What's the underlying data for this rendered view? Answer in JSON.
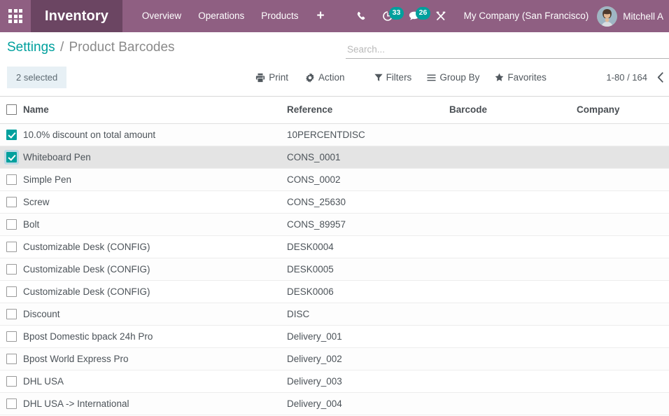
{
  "navbar": {
    "apps_icon": "apps-grid-icon",
    "brand": "Inventory",
    "menu_items": [
      {
        "label": "Overview"
      },
      {
        "label": "Operations"
      },
      {
        "label": "Products"
      }
    ],
    "plus_label": "+",
    "systray": [
      {
        "name": "phone-icon",
        "badge": null
      },
      {
        "name": "activity-clock-icon",
        "badge": "33"
      },
      {
        "name": "messages-chat-icon",
        "badge": "26"
      },
      {
        "name": "tools-wrench-icon",
        "badge": null
      }
    ],
    "company": "My Company (San Francisco)",
    "user_name": "Mitchell A",
    "avatar": "user-avatar",
    "colors": {
      "navbar": "#8f5f82",
      "brand": "#6b4562",
      "badge": "#00a09d"
    }
  },
  "control_panel": {
    "breadcrumb": {
      "root": "Settings",
      "separator": "/",
      "current": "Product Barcodes"
    },
    "search": {
      "value": "",
      "placeholder": "Search..."
    },
    "selection": {
      "label": "2 selected"
    },
    "actions": [
      {
        "label": "Print",
        "icon": "printer-icon"
      },
      {
        "label": "Action",
        "icon": "gear-icon"
      }
    ],
    "filters": [
      {
        "label": "Filters",
        "icon": "filter-funnel-icon"
      },
      {
        "label": "Group By",
        "icon": "group-by-lines-icon"
      },
      {
        "label": "Favorites",
        "icon": "star-icon"
      }
    ],
    "pager": {
      "range": "1-80 / 164",
      "prev_icon": "chevron-left-icon"
    }
  },
  "list": {
    "columns": [
      "Name",
      "Reference",
      "Barcode",
      "Company"
    ],
    "header_checkbox": false,
    "rows": [
      {
        "selected": true,
        "hover": false,
        "name": "10.0% discount on total amount",
        "reference": "10PERCENTDISC",
        "barcode": "",
        "company": ""
      },
      {
        "selected": true,
        "hover": true,
        "name": "Whiteboard Pen",
        "reference": "CONS_0001",
        "barcode": "",
        "company": ""
      },
      {
        "selected": false,
        "hover": false,
        "name": "Simple Pen",
        "reference": "CONS_0002",
        "barcode": "",
        "company": ""
      },
      {
        "selected": false,
        "hover": false,
        "name": "Screw",
        "reference": "CONS_25630",
        "barcode": "",
        "company": ""
      },
      {
        "selected": false,
        "hover": false,
        "name": "Bolt",
        "reference": "CONS_89957",
        "barcode": "",
        "company": ""
      },
      {
        "selected": false,
        "hover": false,
        "name": "Customizable Desk (CONFIG)",
        "reference": "DESK0004",
        "barcode": "",
        "company": ""
      },
      {
        "selected": false,
        "hover": false,
        "name": "Customizable Desk (CONFIG)",
        "reference": "DESK0005",
        "barcode": "",
        "company": ""
      },
      {
        "selected": false,
        "hover": false,
        "name": "Customizable Desk (CONFIG)",
        "reference": "DESK0006",
        "barcode": "",
        "company": ""
      },
      {
        "selected": false,
        "hover": false,
        "name": "Discount",
        "reference": "DISC",
        "barcode": "",
        "company": ""
      },
      {
        "selected": false,
        "hover": false,
        "name": "Bpost Domestic bpack 24h Pro",
        "reference": "Delivery_001",
        "barcode": "",
        "company": ""
      },
      {
        "selected": false,
        "hover": false,
        "name": "Bpost World Express Pro",
        "reference": "Delivery_002",
        "barcode": "",
        "company": ""
      },
      {
        "selected": false,
        "hover": false,
        "name": "DHL USA",
        "reference": "Delivery_003",
        "barcode": "",
        "company": ""
      },
      {
        "selected": false,
        "hover": false,
        "name": "DHL USA -> International",
        "reference": "Delivery_004",
        "barcode": "",
        "company": ""
      }
    ]
  }
}
